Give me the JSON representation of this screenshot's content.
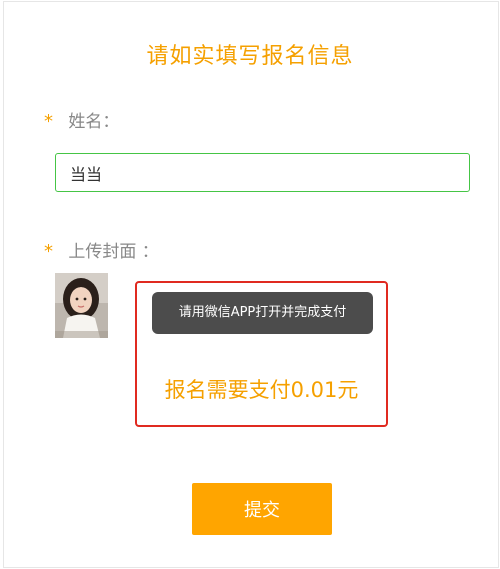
{
  "form": {
    "title": "请如实填写报名信息",
    "required_mark": "*",
    "name_label": "姓名：",
    "name_value": "当当",
    "cover_label": "上传封面 ：",
    "cover_image_caption": "cover-photo-girl"
  },
  "payment": {
    "toast_text": "请用微信APP打开并完成支付",
    "amount_text": "报名需要支付0.01元",
    "highlight_color": "#e02a20"
  },
  "actions": {
    "submit_label": "提交"
  },
  "colors": {
    "accent": "#f5a000",
    "button": "#ffa500",
    "input_border": "#45c545",
    "toast_bg": "#4c4c4c"
  }
}
